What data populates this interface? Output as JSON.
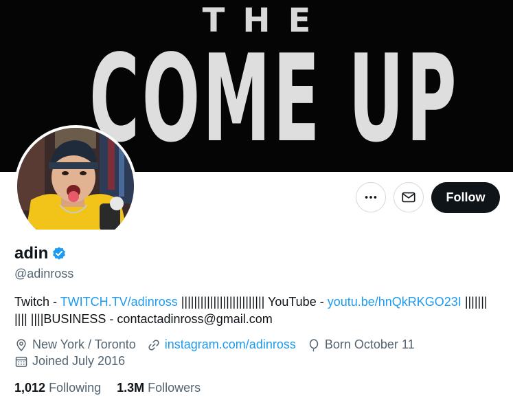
{
  "banner": {
    "line1": "THE",
    "line2": "COME UP"
  },
  "profile": {
    "display_name": "adin",
    "handle": "@adinross",
    "verified_icon": "verified-badge-icon",
    "accent_color": "#1d9bf0"
  },
  "actions": {
    "more_icon": "more-options-icon",
    "message_icon": "envelope-icon",
    "follow_label": "Follow"
  },
  "bio": {
    "part1": "Twitch - ",
    "link1": "TWITCH.TV/adinross",
    "part2": " |||||||||||||||||||||||||| YouTube - ",
    "link2": "youtu.be/hnQkRKGO23I",
    "part3": " ||||||| |||| ||||BUSINESS - contactadinross@gmail.com"
  },
  "meta": {
    "location": "New York / Toronto",
    "website": "instagram.com/adinross",
    "birthday": "Born October 11",
    "joined": "Joined July 2016"
  },
  "stats": {
    "following_count": "1,012",
    "following_label": "Following",
    "followers_count": "1.3M",
    "followers_label": "Followers"
  }
}
